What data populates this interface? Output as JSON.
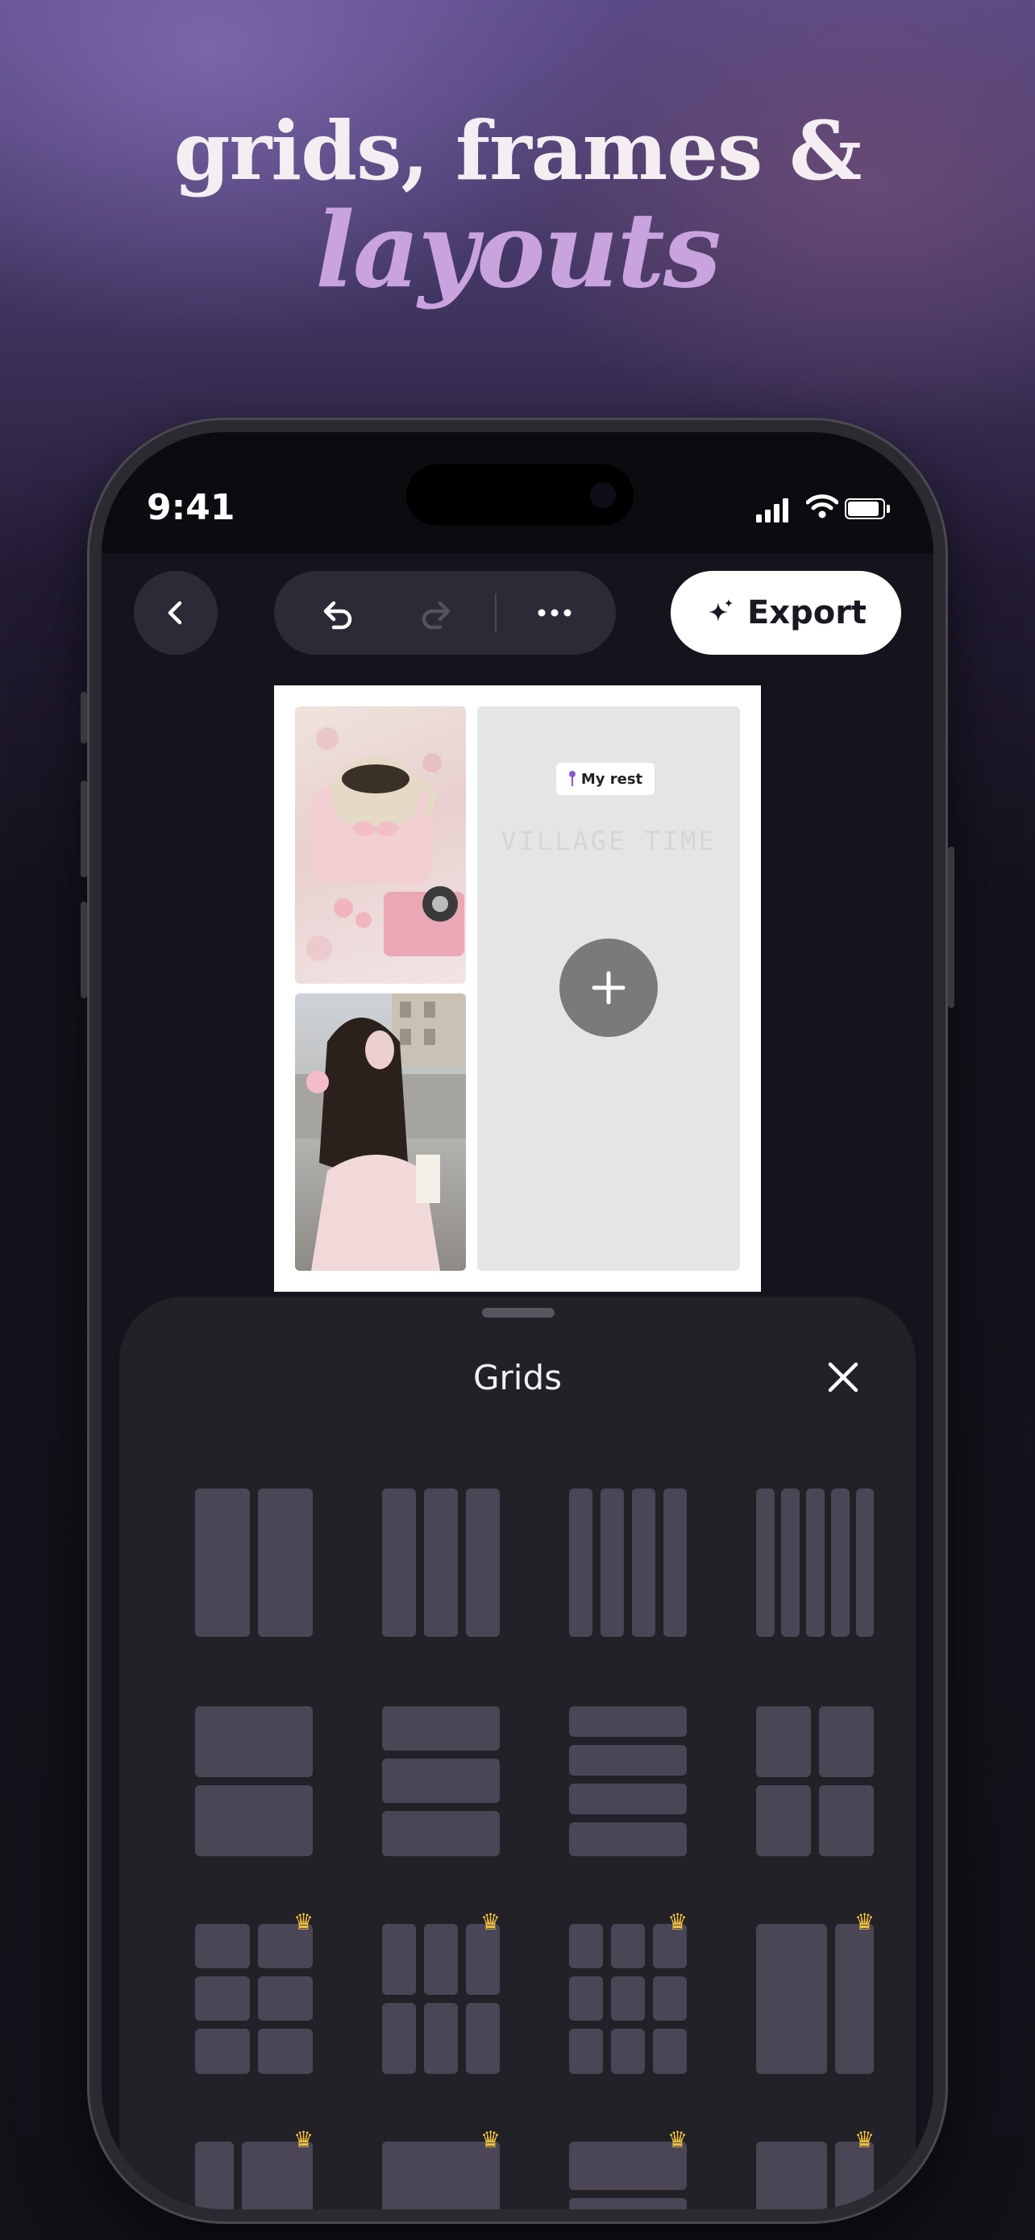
{
  "promo": {
    "line1": "grids, frames &",
    "line2": "layouts"
  },
  "status": {
    "time": "9:41"
  },
  "toolbar": {
    "back_icon": "chevron-left-icon",
    "undo_icon": "undo-icon",
    "redo_icon": "redo-icon",
    "more_icon": "more-icon",
    "export_label": "Export",
    "export_icon": "sparkle-icon"
  },
  "canvas": {
    "label_text": "My rest",
    "ghost_text": "VILLAGE TIME",
    "add_icon": "plus-icon"
  },
  "sheet": {
    "title": "Grids",
    "close_icon": "close-icon",
    "premium_icon": "crown-icon",
    "accent_color": "#f3c13f"
  }
}
